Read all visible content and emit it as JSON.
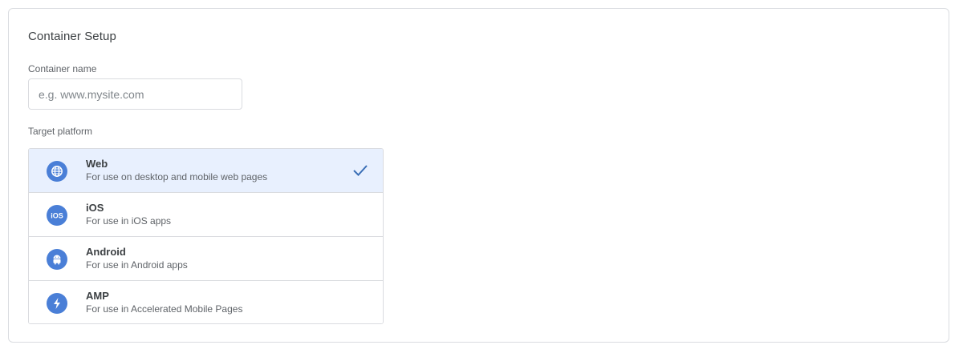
{
  "card": {
    "title": "Container Setup"
  },
  "container_name": {
    "label": "Container name",
    "placeholder": "e.g. www.mysite.com",
    "value": ""
  },
  "target_platform": {
    "label": "Target platform",
    "options": [
      {
        "name": "Web",
        "description": "For use on desktop and mobile web pages",
        "icon": "globe-icon",
        "selected": true
      },
      {
        "name": "iOS",
        "description": "For use in iOS apps",
        "icon": "ios-icon",
        "selected": false
      },
      {
        "name": "Android",
        "description": "For use in Android apps",
        "icon": "android-icon",
        "selected": false
      },
      {
        "name": "AMP",
        "description": "For use in Accelerated Mobile Pages",
        "icon": "lightning-icon",
        "selected": false
      }
    ],
    "selected_icon": "check-icon"
  },
  "colors": {
    "accent": "#4a7fd7",
    "selected_background": "#e8f0fe",
    "border": "#dadce0",
    "check": "#3b6fb6"
  }
}
